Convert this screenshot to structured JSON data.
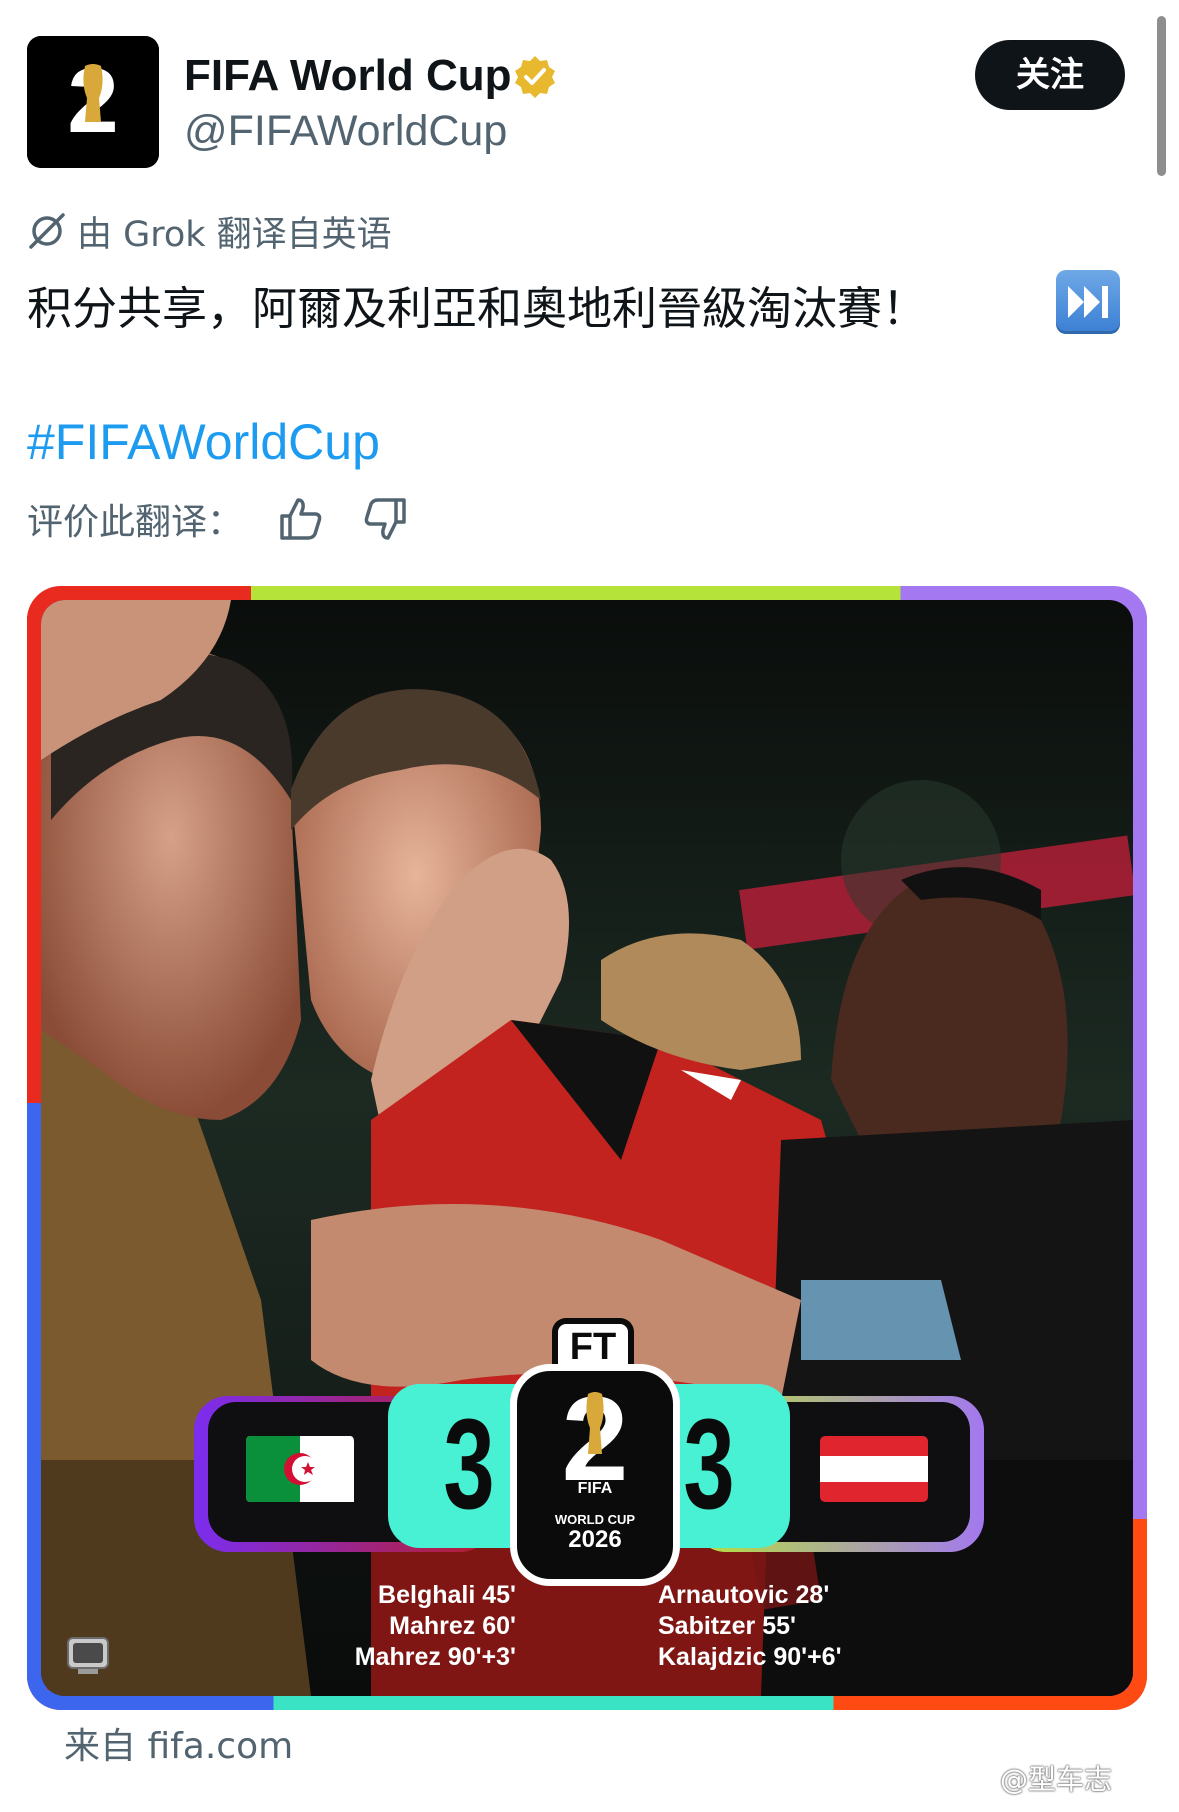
{
  "account": {
    "name": "FIFA World Cup",
    "handle": "@FIFAWorldCup",
    "verified": true,
    "follow_label": "关注",
    "avatar_fifa_text": "FIFA"
  },
  "translation": {
    "label": "由 Grok 翻译自英语",
    "rate_label": "评价此翻译："
  },
  "post": {
    "text": "积分共享，阿爾及利亞和奧地利晉級淘汰賽！",
    "emoji": "fast-forward-emoji",
    "hashtag": "#FIFAWorldCup"
  },
  "media": {
    "status": "FT",
    "badge": {
      "fifa": "FIFA",
      "line1": "WORLD CUP",
      "line2": "2026"
    },
    "home": {
      "flag": "algeria-flag",
      "score": "3",
      "scorers": [
        "Belghali 45'",
        "Mahrez 60'",
        "Mahrez 90'+3'"
      ]
    },
    "away": {
      "flag": "austria-flag",
      "score": "3",
      "scorers": [
        "Arnautovic 28'",
        "Sabitzer 55'",
        "Kalajdzic 90'+6'"
      ]
    },
    "source": "来自 fifa.com"
  },
  "watermark": "@型车志",
  "colors": {
    "accent_link": "#1d9bf0",
    "muted_text": "#536471",
    "score_box": "#48f1d3",
    "frame_red": "#e82a1f",
    "frame_green": "#b6e33a",
    "frame_purple": "#a378f0",
    "frame_blue": "#3d66ef",
    "frame_orange": "#ff4a14"
  }
}
